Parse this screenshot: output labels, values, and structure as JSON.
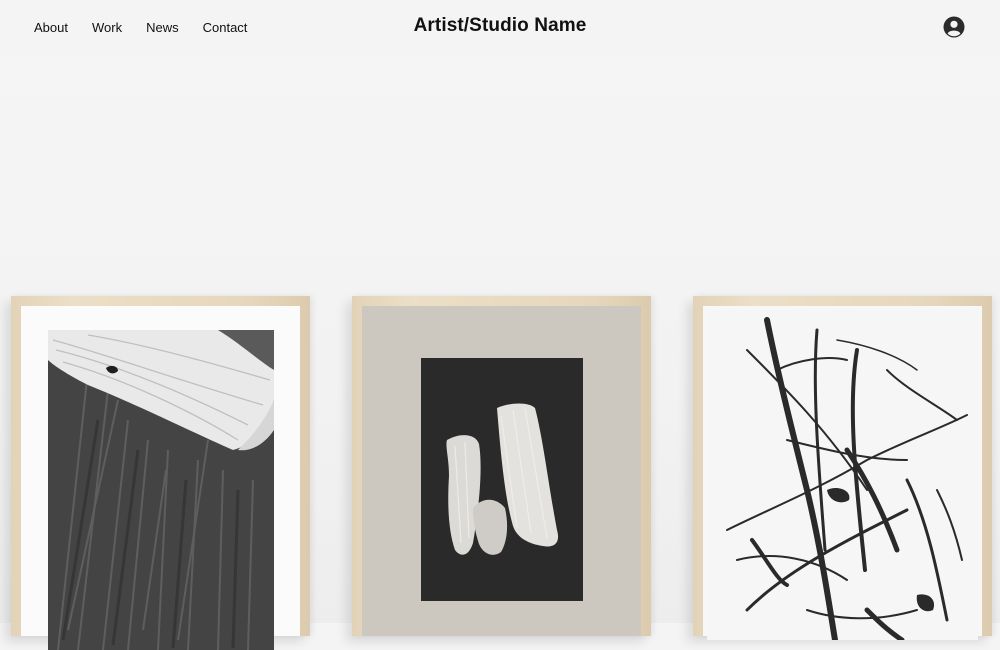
{
  "header": {
    "nav": [
      {
        "label": "About"
      },
      {
        "label": "Work"
      },
      {
        "label": "News"
      },
      {
        "label": "Contact"
      }
    ],
    "site_title": "Artist/Studio Name",
    "login_icon": "user-avatar-icon"
  },
  "artworks": [
    {
      "mat_color": "#fbfbfb",
      "art_bg": "#3e3e3e"
    },
    {
      "mat_color": "#cdc8bf",
      "art_bg": "#282828"
    },
    {
      "mat_color": "#f7f7f7",
      "art_bg": "#f7f7f7"
    }
  ],
  "colors": {
    "background": "#f4f4f4",
    "text": "#111111",
    "frame_wood": "#e6d7bc"
  }
}
